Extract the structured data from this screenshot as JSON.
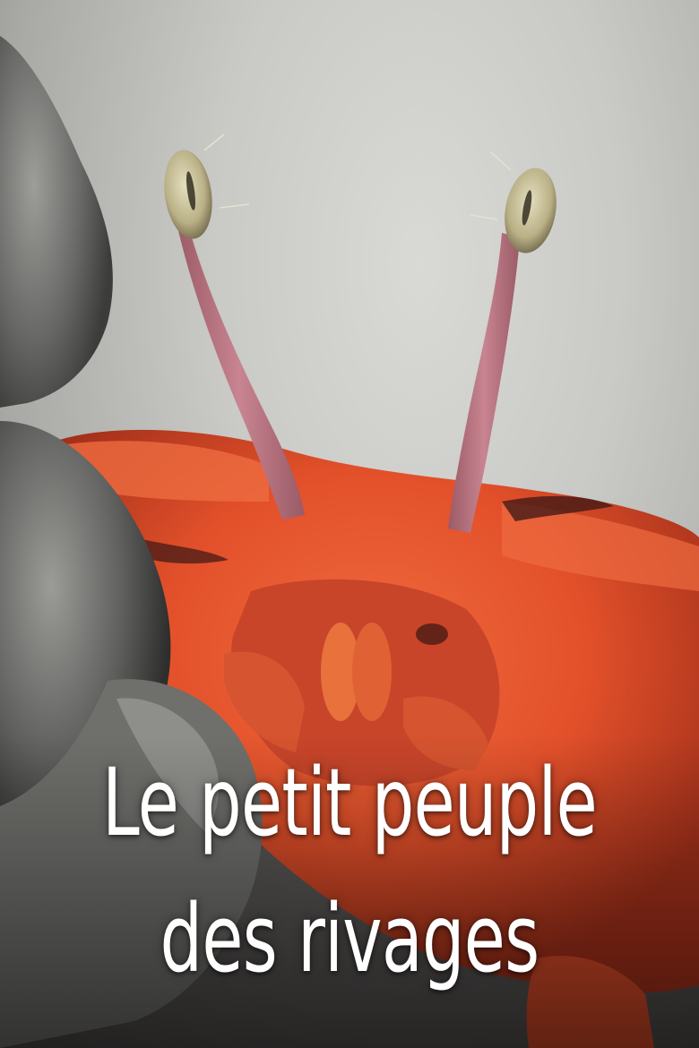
{
  "poster": {
    "title_line_1": "Le petit peuple",
    "title_line_2": "des rivages"
  },
  "colors": {
    "background": "#c9c9c6",
    "crab_body": "#e2502a",
    "crab_shadow": "#a3301a",
    "eye_stalk": "#b9727e",
    "eye": "#c9c29a",
    "rock": "#5f5f5d",
    "title_text": "#ffffff"
  }
}
